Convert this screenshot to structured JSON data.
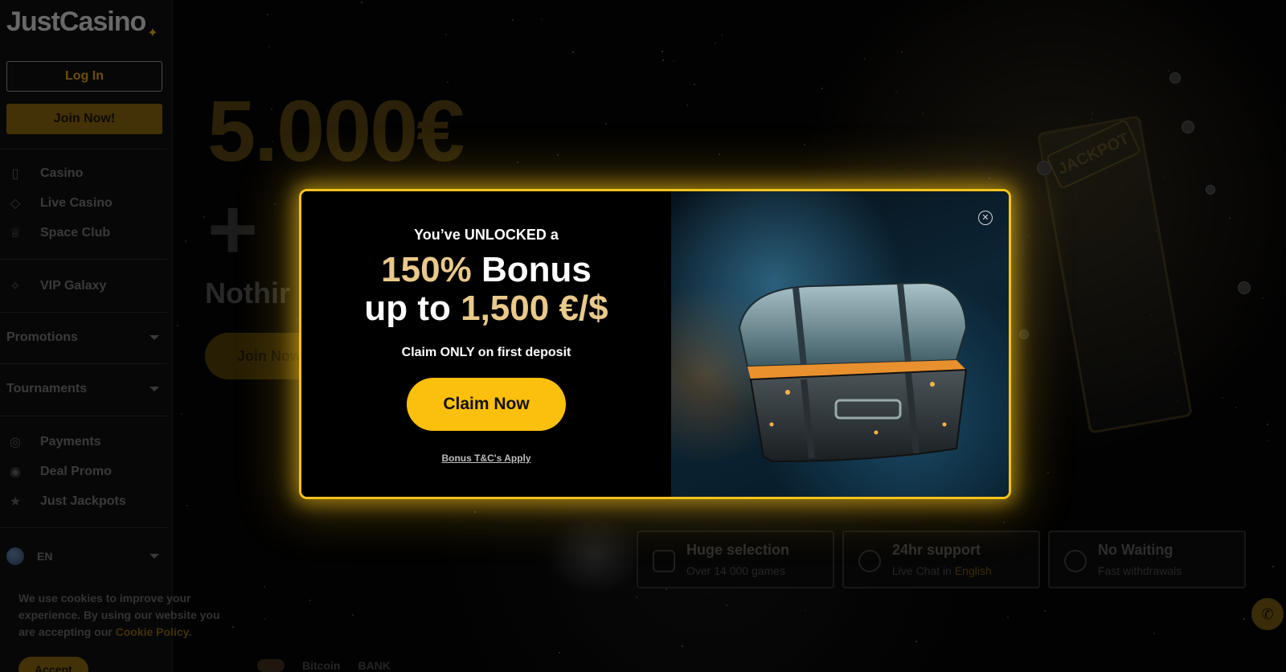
{
  "brand": {
    "name": "JustCasino",
    "logo_mark": "✦"
  },
  "auth": {
    "login_label": "Log In",
    "join_label": "Join Now!"
  },
  "sidebar": {
    "items_primary": [
      {
        "label": "Casino",
        "icon": "card-icon"
      },
      {
        "label": "Live Casino",
        "icon": "dice-icon"
      },
      {
        "label": "Space Club",
        "icon": "crown-icon"
      }
    ],
    "vip": {
      "label": "VIP Galaxy",
      "icon": "sparkle-icon"
    },
    "sections": [
      {
        "label": "Promotions"
      },
      {
        "label": "Tournaments"
      }
    ],
    "items_secondary": [
      {
        "label": "Payments",
        "icon": "coins-icon"
      },
      {
        "label": "Deal Promo",
        "icon": "target-icon"
      },
      {
        "label": "Just Jackpots",
        "icon": "stars-icon"
      }
    ],
    "language": "EN"
  },
  "cookie": {
    "text_before": "We use cookies to improve your experience. By using our website you are accepting our ",
    "link": "Cookie Policy",
    "text_after": ".",
    "accept_label": "Accept"
  },
  "hero": {
    "amount": "5.000€",
    "plus": "+",
    "subtitle": "Nothir",
    "cta": "Join Now"
  },
  "features": [
    {
      "title": "Huge selection",
      "subtitle": "Over 14 000 games",
      "icon": "dice-icon"
    },
    {
      "title": "24hr support",
      "subtitle_prefix": "Live Chat in ",
      "subtitle_highlight": "English",
      "icon": "phone-icon"
    },
    {
      "title": "No Waiting",
      "subtitle": "Fast withdrawals",
      "icon": "clock-icon"
    }
  ],
  "payments": {
    "bitcoin": "Bitcoin",
    "bank": "BANK"
  },
  "slot_label": "JACKPOT",
  "modal": {
    "unlock_text": "You’ve UNLOCKED a",
    "headline_percent": "150%",
    "headline_bonus": " Bonus",
    "headline_upto": "up to ",
    "headline_amount": "1,500 €/$",
    "claim_only": "Claim ONLY on first deposit",
    "claim_button": "Claim Now",
    "terms_link": "Bonus T&C's Apply",
    "close_icon": "close-icon",
    "image": "treasure-chest-illustration"
  },
  "colors": {
    "accent": "#fbbf0d",
    "gold_text": "#e9c98a",
    "modal_border": "#f5c21a"
  }
}
